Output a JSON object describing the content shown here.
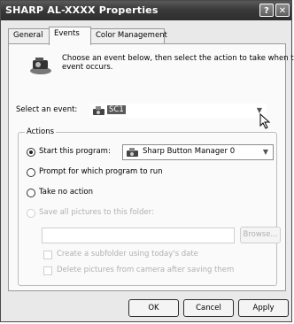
{
  "window": {
    "title": "SHARP AL-XXXX Properties",
    "help_glyph": "?",
    "close_glyph": "✕"
  },
  "tabs": [
    {
      "label": "General"
    },
    {
      "label": "Events"
    },
    {
      "label": "Color Management"
    }
  ],
  "intro": {
    "text_line1": "Choose an event below, then select the action to take when that",
    "text_line2": "event occurs."
  },
  "event": {
    "label": "Select an event:",
    "value": "SC1"
  },
  "actions": {
    "title": "Actions",
    "start_program_label": "Start this program:",
    "program_value": "Sharp Button Manager 0",
    "prompt_label": "Prompt for which program to run",
    "no_action_label": "Take no action",
    "save_label": "Save all pictures to this folder:",
    "folder_value": "",
    "browse_label": "Browse...",
    "subfolder_label": "Create a subfolder using today's date",
    "delete_label": "Delete pictures from camera after saving them"
  },
  "footer": {
    "ok_label": "OK",
    "cancel_label": "Cancel",
    "apply_label": "Apply"
  }
}
